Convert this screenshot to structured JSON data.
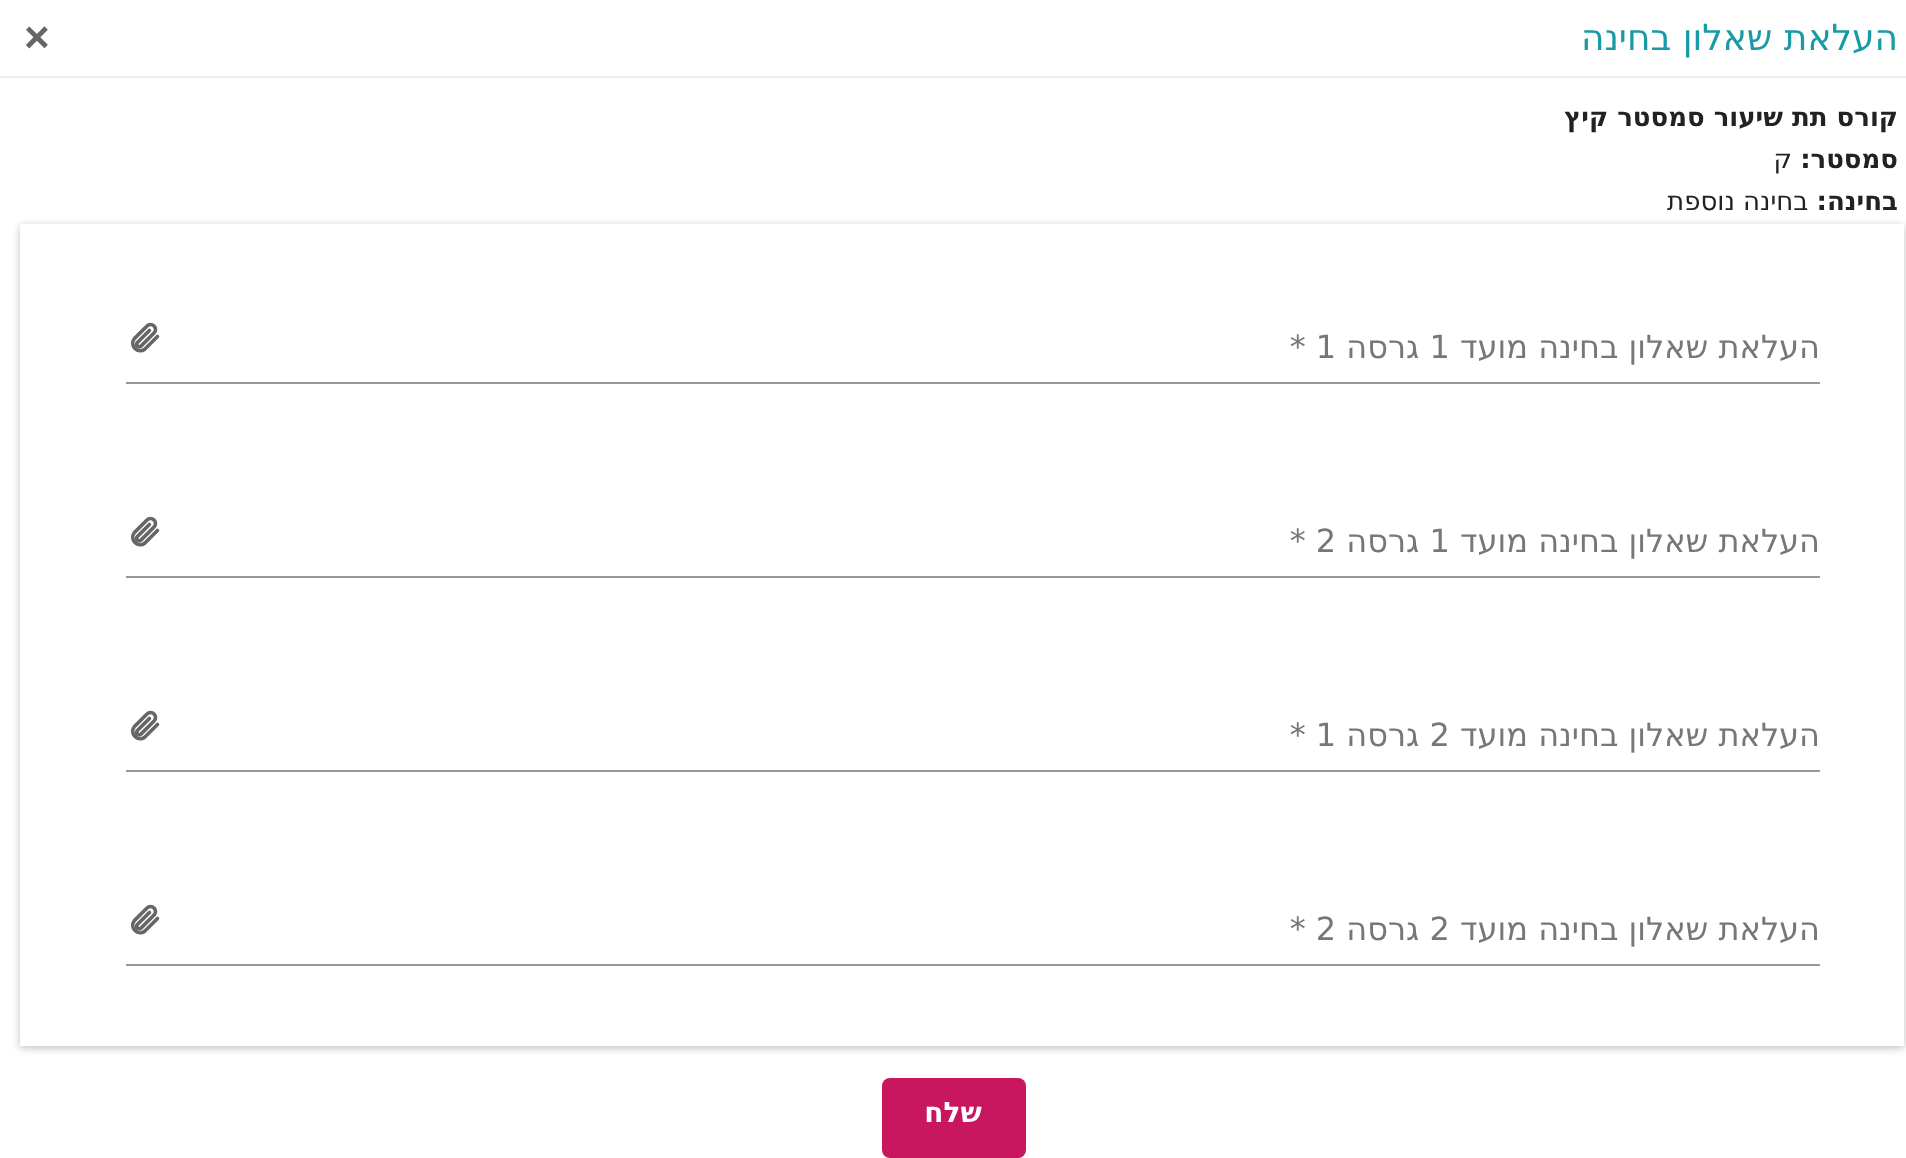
{
  "dialog": {
    "title": "העלאת שאלון בחינה",
    "close": "×"
  },
  "info": [
    {
      "text": "קורס תת שיעור סמסטר קיץ",
      "bold": true
    },
    {
      "text": "**סמסטר:** ק",
      "bold": false
    },
    {
      "text": "**בחינה:** בחינה נוספת",
      "bold": false
    }
  ],
  "fields": [
    {
      "placeholder": "העלאת שאלון בחינה מועד 1 גרסה 1 *"
    },
    {
      "placeholder": "העלאת שאלון בחינה מועד 1 גרסה 2 *"
    },
    {
      "placeholder": "העלאת שאלון בחינה מועד 2 גרסה 1 *"
    },
    {
      "placeholder": "העלאת שאלון בחינה מועד 2 גרסה 2 *"
    }
  ],
  "submit": "שלח"
}
